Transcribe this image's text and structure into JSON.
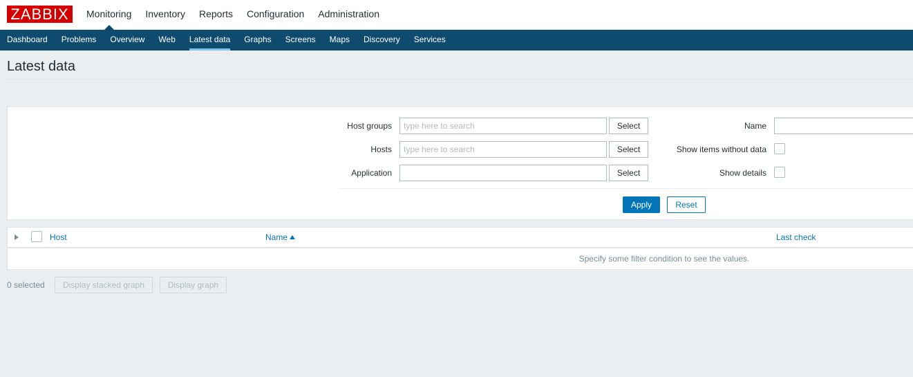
{
  "logo": "ZABBIX",
  "main_nav": [
    "Monitoring",
    "Inventory",
    "Reports",
    "Configuration",
    "Administration"
  ],
  "sub_nav": [
    "Dashboard",
    "Problems",
    "Overview",
    "Web",
    "Latest data",
    "Graphs",
    "Screens",
    "Maps",
    "Discovery",
    "Services"
  ],
  "page_title": "Latest data",
  "filter": {
    "host_groups_label": "Host groups",
    "host_groups_placeholder": "type here to search",
    "hosts_label": "Hosts",
    "hosts_placeholder": "type here to search",
    "application_label": "Application",
    "application_value": "",
    "select_label": "Select",
    "name_label": "Name",
    "name_value": "",
    "show_items_without_data_label": "Show items without data",
    "show_details_label": "Show details",
    "apply_label": "Apply",
    "reset_label": "Reset"
  },
  "table": {
    "col_host": "Host",
    "col_name": "Name",
    "col_last_check": "Last check",
    "empty_message": "Specify some filter condition to see the values."
  },
  "footer": {
    "selected_count": "0 selected",
    "display_stacked_graph": "Display stacked graph",
    "display_graph": "Display graph"
  }
}
